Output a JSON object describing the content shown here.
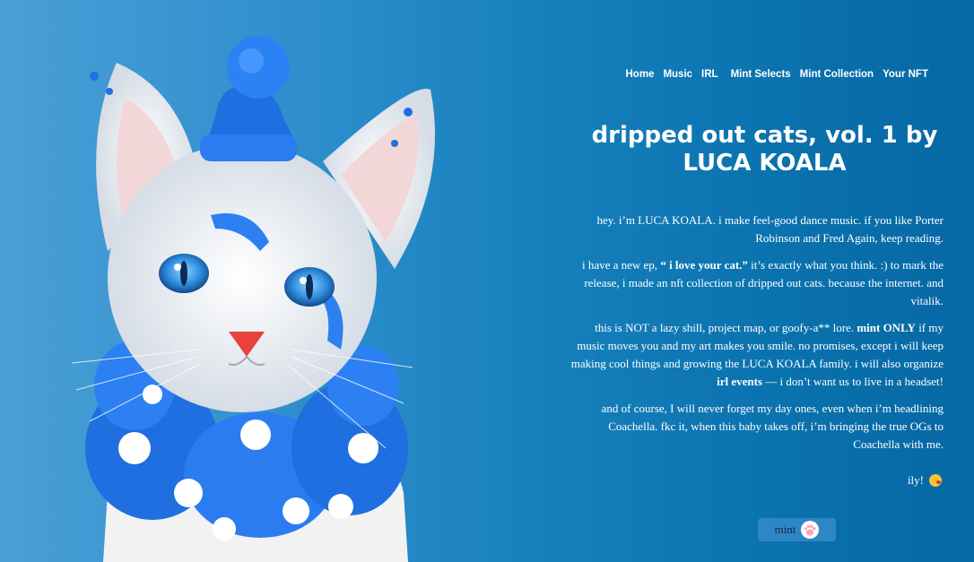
{
  "nav": {
    "items": [
      "Home",
      "Music",
      "IRL",
      "Mint Selects",
      "Mint Collection",
      "Your NFT"
    ]
  },
  "page_title": "dripped out cats, vol. 1 by LUCA KOALA",
  "intro": {
    "p1": "hey. i’m LUCA KOALA. i make feel-good dance music. if you like Porter Robinson and Fred Again, keep reading.",
    "p2_before": "i have a new ep, ",
    "p2_ep": "“ i love your cat.”",
    "p2_after": " it’s exactly what you think. :) to mark the release, i made an nft collection of dripped out cats. because the internet. and vitalik.",
    "p3_before": "this is NOT a lazy shill, project map, or goofy-a** lore. ",
    "p3_bold": "mint ONLY",
    "p3_middle": " if my music moves you and my art makes you smile. no promises, except i will keep making cool things and growing the LUCA KOALA family. i will also organize ",
    "p3_bold2": "irl events",
    "p3_after": " — i don’t want us to live in a headset!",
    "p4": "and of course, I will never forget my day ones, even when i’m headlining Coachella. fkc it, when this baby takes off, i’m bringing the true OGs to Coachella with me."
  },
  "sign_off": "ily!",
  "mint_button": {
    "label": "mint"
  },
  "colors": {
    "background": "#1781bd",
    "button": "#2e87c4",
    "cat_blue": "#1f6fe0"
  }
}
